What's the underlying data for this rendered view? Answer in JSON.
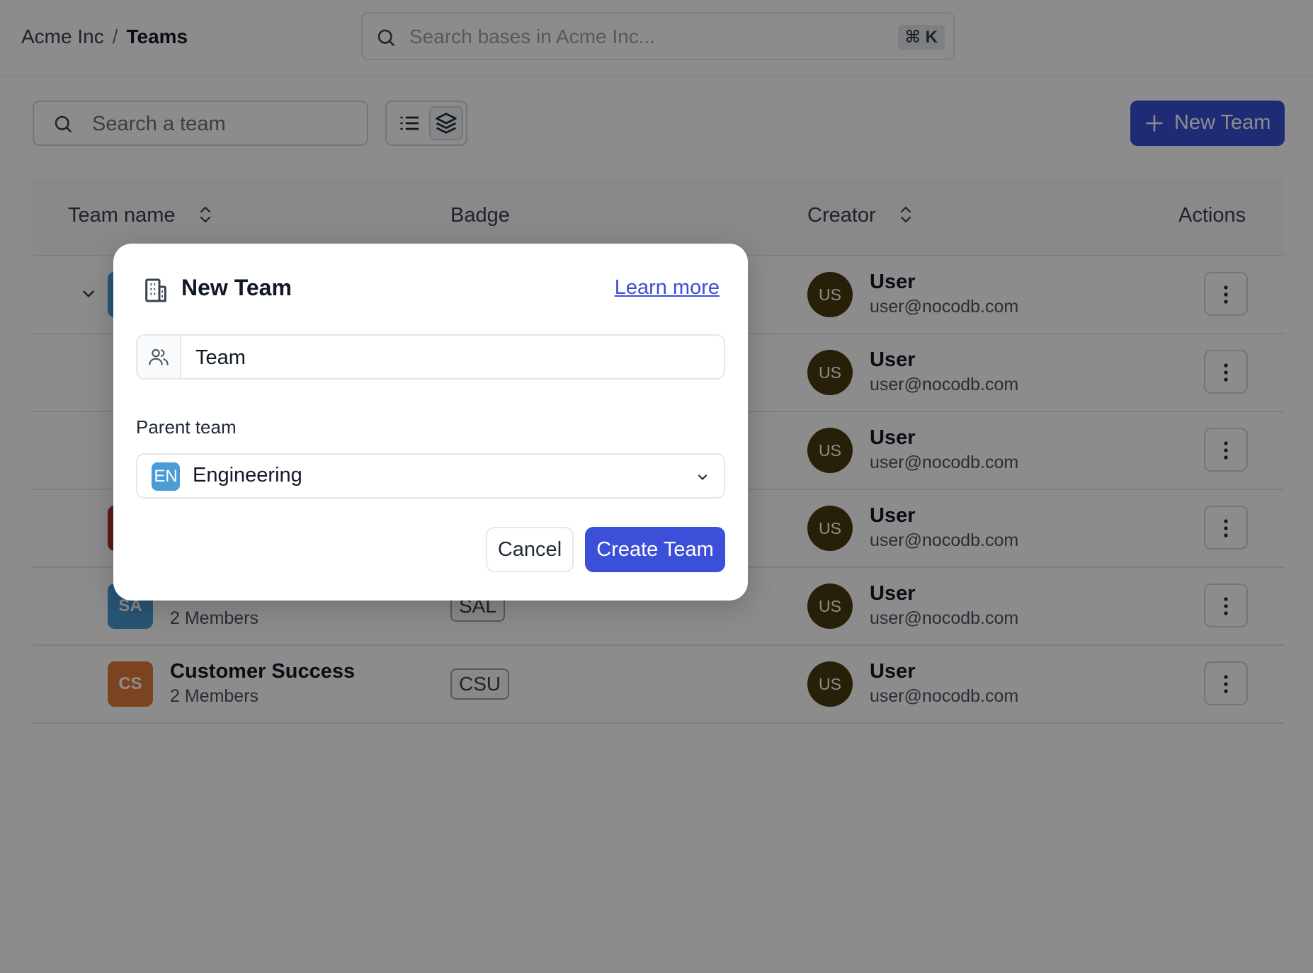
{
  "topbar": {
    "breadcrumb": {
      "workspace": "Acme Inc",
      "separator": "/",
      "current": "Teams"
    },
    "search": {
      "placeholder": "Search bases in Acme Inc...",
      "shortcut": "⌘ K"
    }
  },
  "toolbar": {
    "search": {
      "placeholder": "Search a team"
    },
    "new_team_label": "New Team"
  },
  "table": {
    "columns": {
      "team_name": "Team name",
      "badge": "Badge",
      "creator": "Creator",
      "actions": "Actions"
    },
    "rows": [
      {
        "avatar": "",
        "avatar_color": "#4a9bd6",
        "name": "",
        "members": "",
        "badge": "",
        "creator_initials": "US",
        "creator_name": "User",
        "creator_email": "user@nocodb.com",
        "expandable": true
      },
      {
        "avatar": "",
        "avatar_color": "",
        "name": "",
        "members": "",
        "badge": "",
        "creator_initials": "US",
        "creator_name": "User",
        "creator_email": "user@nocodb.com"
      },
      {
        "avatar": "",
        "avatar_color": "",
        "name": "",
        "members": "",
        "badge": "",
        "creator_initials": "US",
        "creator_name": "User",
        "creator_email": "user@nocodb.com"
      },
      {
        "avatar": "",
        "avatar_color": "#b0332a",
        "name": "",
        "members": "",
        "badge": "",
        "creator_initials": "US",
        "creator_name": "User",
        "creator_email": "user@nocodb.com"
      },
      {
        "avatar": "SA",
        "avatar_color": "#4a9bd6",
        "name": "",
        "members": "2 Members",
        "badge": "SAL",
        "creator_initials": "US",
        "creator_name": "User",
        "creator_email": "user@nocodb.com"
      },
      {
        "avatar": "CS",
        "avatar_color": "#e07a3a",
        "name": "Customer Success",
        "members": "2 Members",
        "badge": "CSU",
        "creator_initials": "US",
        "creator_name": "User",
        "creator_email": "user@nocodb.com"
      }
    ]
  },
  "modal": {
    "title": "New Team",
    "learn_more": "Learn more",
    "team_name_value": "Team",
    "parent_label": "Parent team",
    "parent_initials": "EN",
    "parent_value": "Engineering",
    "cancel_label": "Cancel",
    "create_label": "Create Team"
  },
  "colors": {
    "primary": "#3b4fd8",
    "creator_avatar": "#4a3a0f",
    "overlay": "rgba(0,0,0,0.45)"
  }
}
